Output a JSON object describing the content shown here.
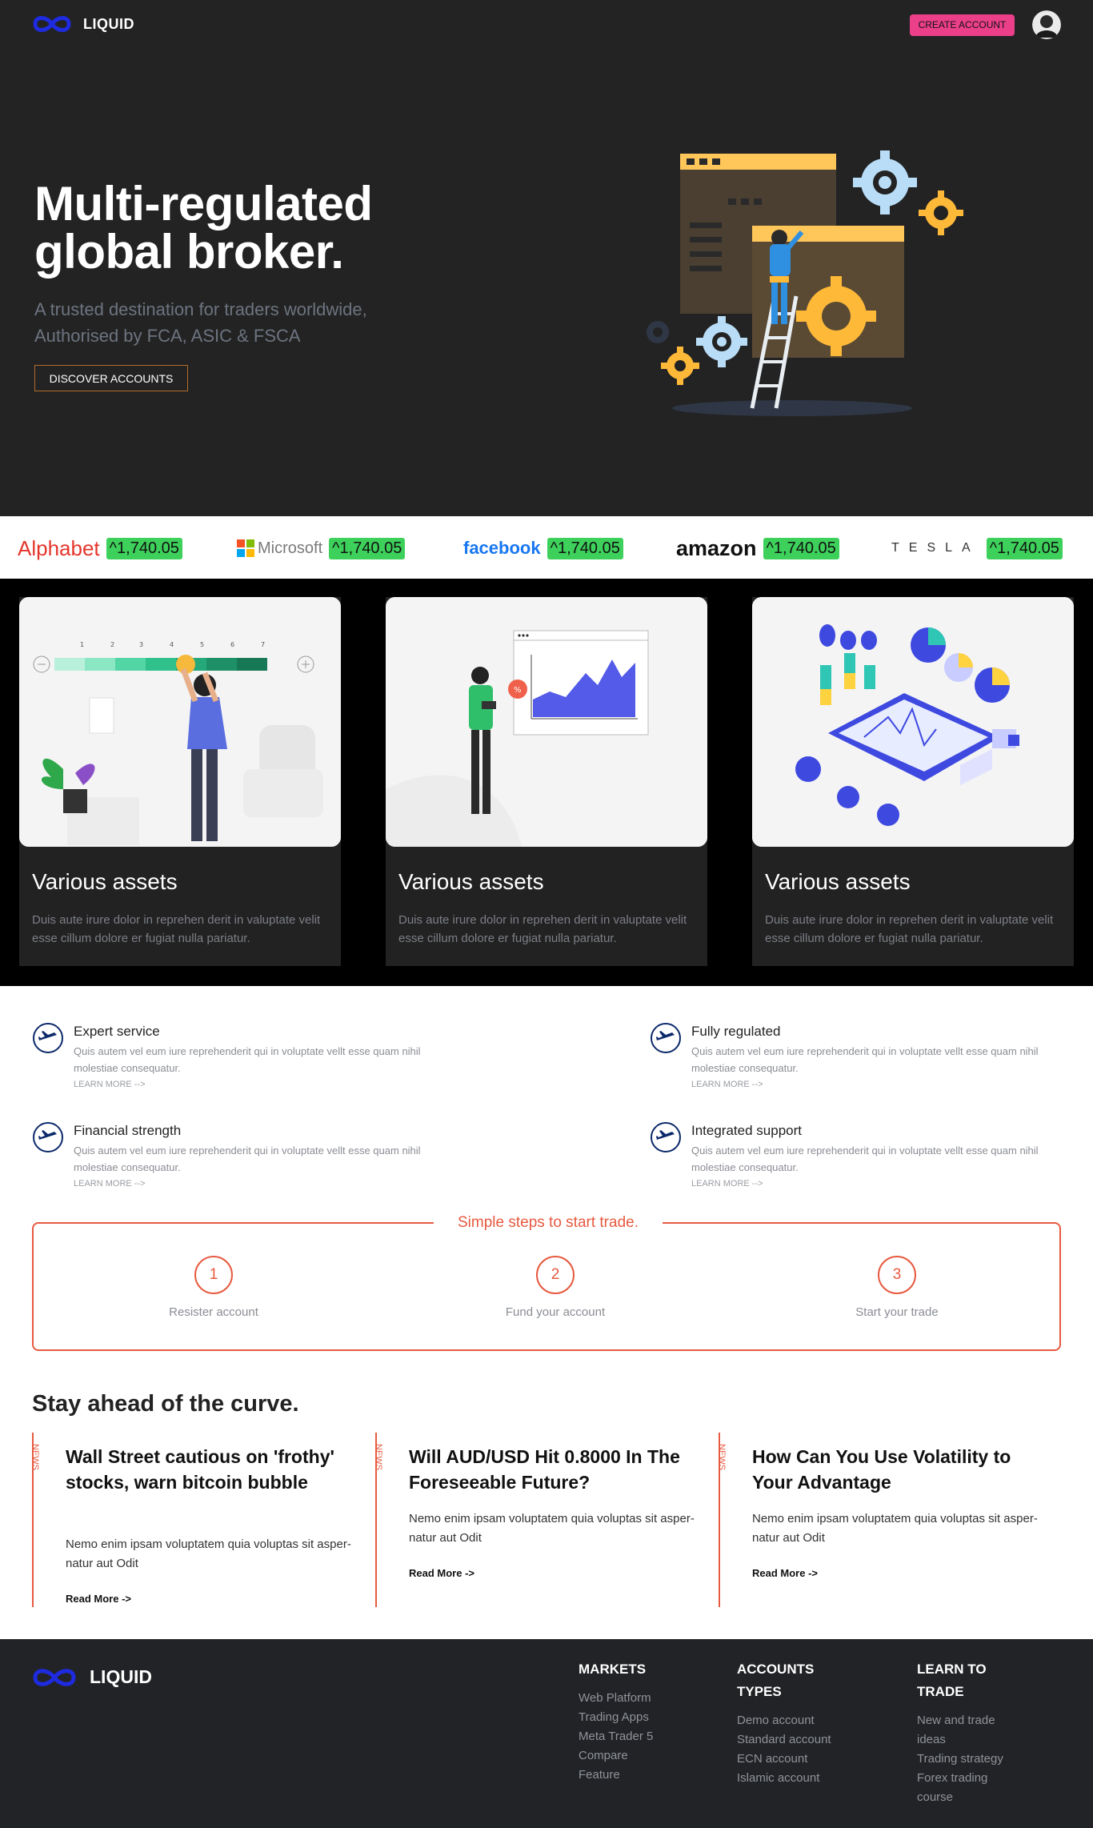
{
  "brand": {
    "name": "LIQUID",
    "accent": "#ec3f8a",
    "orange": "#e75a40"
  },
  "nav": {
    "create_account": "CREATE ACCOUNT"
  },
  "hero": {
    "title_line1": "Multi-regulated",
    "title_line2": "global broker.",
    "subtitle_line1": "A trusted destination for traders worldwide,",
    "subtitle_line2": "Authorised by FCA, ASIC & FSCA",
    "cta": "DISCOVER ACCOUNTS"
  },
  "ticker": [
    {
      "company": "Alphabet",
      "price": "^1,740.05"
    },
    {
      "company": "Microsoft",
      "price": "^1,740.05"
    },
    {
      "company": "facebook",
      "price": "^1,740.05"
    },
    {
      "company": "amazon",
      "price": "^1,740.05"
    },
    {
      "company": "TESLA",
      "price": "^1,740.05"
    }
  ],
  "cards": [
    {
      "title": "Various assets",
      "text": "Duis aute irure dolor in reprehen derit in valuptate velit esse cillum dolore er fugiat nulla pariatur."
    },
    {
      "title": "Various assets",
      "text": "Duis aute irure dolor in reprehen derit in valuptate velit esse cillum dolore er fugiat nulla pariatur."
    },
    {
      "title": "Various assets",
      "text": "Duis aute irure dolor in reprehen derit in valuptate velit esse cillum dolore er fugiat nulla pariatur."
    }
  ],
  "slider_ticks": [
    "1",
    "2",
    "3",
    "4",
    "5",
    "6",
    "7"
  ],
  "features": [
    {
      "title": "Expert service",
      "text": "Quis autem vel eum iure reprehenderit qui in voluptate vellt esse quam nihil molestiae consequatur.",
      "link": "LEARN MORE -->"
    },
    {
      "title": "Fully regulated",
      "text": "Quis autem vel eum iure reprehenderit qui in voluptate vellt esse quam nihil molestiae consequatur.",
      "link": "LEARN MORE -->"
    },
    {
      "title": "Financial strength",
      "text": "Quis autem vel eum iure reprehenderit qui in voluptate vellt esse quam nihil molestiae consequatur.",
      "link": "LEARN MORE -->"
    },
    {
      "title": "Integrated support",
      "text": "Quis autem vel eum iure reprehenderit qui in voluptate vellt esse quam nihil molestiae consequatur.",
      "link": "LEARN MORE -->"
    }
  ],
  "steps": {
    "title": "Simple steps to start trade.",
    "items": [
      {
        "num": "1",
        "label": "Resister account"
      },
      {
        "num": "2",
        "label": "Fund your account"
      },
      {
        "num": "3",
        "label": "Start your trade"
      }
    ]
  },
  "news": {
    "heading": "Stay ahead of the curve.",
    "tag": "NEWS",
    "items": [
      {
        "title": "Wall Street cautious on 'frothy' stocks, warn bitcoin bubble",
        "text": "Nemo enim ipsam voluptatem quia voluptas sit asper-natur aut Odit",
        "more": "Read More ->"
      },
      {
        "title": "Will AUD/USD Hit 0.8000 In The Foreseeable Future?",
        "text": "Nemo enim ipsam voluptatem quia voluptas sit asper-natur aut Odit",
        "more": "Read More ->"
      },
      {
        "title": "How Can You Use Volatility to Your Advantage",
        "text": "Nemo enim ipsam voluptatem quia voluptas sit asper-natur aut Odit",
        "more": "Read More ->"
      }
    ]
  },
  "footer": {
    "markets": {
      "head": "MARKETS",
      "items": [
        "Web Platform",
        "Trading Apps",
        "Meta Trader 5",
        "Compare",
        "Feature"
      ]
    },
    "accounts": {
      "head_line1": "ACCOUNTS",
      "head_line2": "TYPES",
      "items": [
        "Demo account",
        "Standard account",
        "ECN account",
        "Islamic account"
      ]
    },
    "learn": {
      "head_line1": "LEARN TO",
      "head_line2": "TRADE",
      "items": [
        "New and trade",
        "ideas",
        "Trading strategy",
        "Forex trading",
        "course"
      ]
    }
  }
}
